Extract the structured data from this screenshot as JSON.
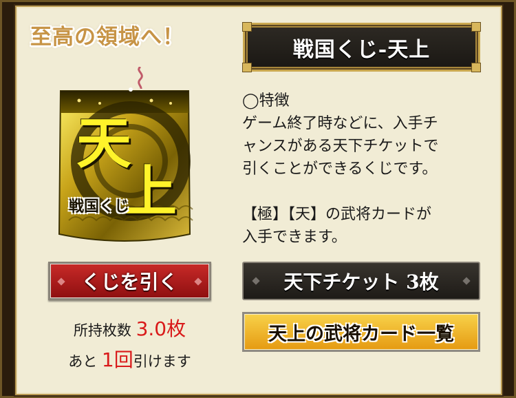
{
  "headline": "至高の領域へ！",
  "ticket": {
    "main_char_1": "天",
    "main_char_2": "上",
    "sub_label": "戦国くじ"
  },
  "title": "戦国くじ-天上",
  "description": {
    "heading": "◯特徴",
    "lines": [
      "ゲーム終了時などに、入手チ",
      "ャンスがある天下チケットで",
      "引くことができるくじです。",
      "【極】【天】の武将カードが",
      "入手できます。"
    ]
  },
  "draw_button": "くじを引く",
  "ticket_count": "天下チケット 3枚",
  "list_button": "天上の武将カード一覧",
  "holding": {
    "label": "所持枚数",
    "value": "3.0",
    "unit": "枚"
  },
  "remaining": {
    "prefix": "あと",
    "value": "1",
    "unit": "回",
    "suffix": "引けます"
  },
  "colors": {
    "panel_bg": "#f1ecd5",
    "accent_red": "#d91a1a",
    "gold": "#caa84f"
  }
}
